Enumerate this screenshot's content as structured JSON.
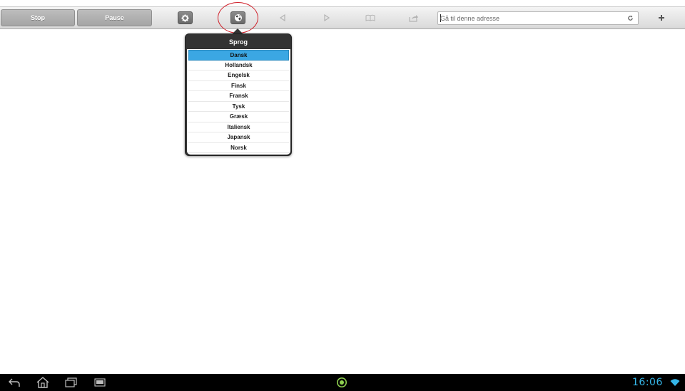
{
  "toolbar": {
    "stop_label": "Stop",
    "pause_label": "Pause",
    "address_placeholder": "Gå til denne adresse"
  },
  "language_popup": {
    "title": "Sprog",
    "languages": [
      "Dansk",
      "Hollandsk",
      "Engelsk",
      "Finsk",
      "Fransk",
      "Tysk",
      "Græsk",
      "Italiensk",
      "Japansk",
      "Norsk"
    ],
    "selected": "Dansk"
  },
  "system_bar": {
    "clock": "16:06"
  },
  "colors": {
    "selection": "#3ba7e3",
    "highlight_circle": "#d0202a",
    "clock": "#35b6e8",
    "notification": "#8fd14f"
  },
  "icons": [
    "gear-icon",
    "globe-icon",
    "back-arrow-icon",
    "forward-arrow-icon",
    "bookmarks-icon",
    "share-icon",
    "refresh-icon",
    "plus-icon",
    "android-back-icon",
    "android-home-icon",
    "android-recent-apps-icon",
    "usb-icon",
    "notification-icon",
    "wifi-icon"
  ]
}
